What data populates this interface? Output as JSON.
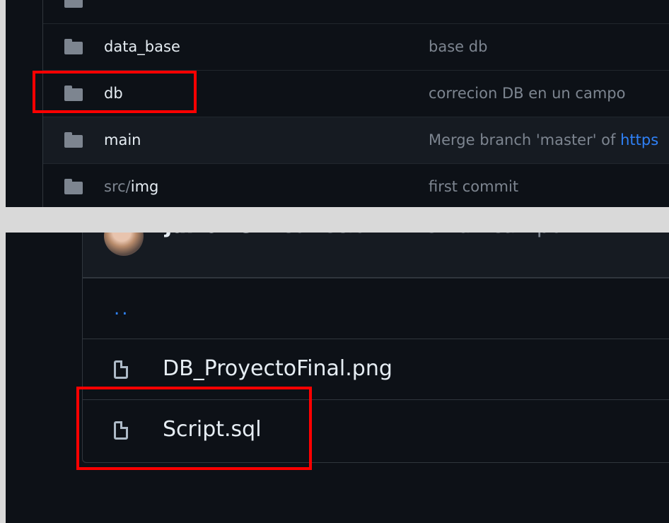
{
  "top_list": {
    "rows": [
      {
        "name": "data_base",
        "message": "base db"
      },
      {
        "name": "db",
        "message": "correcion DB en un campo"
      },
      {
        "name": "main",
        "message_prefix": "Merge branch 'master' of ",
        "message_link": "https"
      },
      {
        "name_prefix": "src/",
        "name": "img",
        "message": "first commit"
      }
    ]
  },
  "bottom_list": {
    "commit": {
      "author": "jairoDGM",
      "message": "correcion DB en un campo"
    },
    "parent_link": "..",
    "files": [
      {
        "name": "DB_ProyectoFinal.png"
      },
      {
        "name": "Script.sql"
      }
    ]
  },
  "highlight_color": "#ff0000"
}
